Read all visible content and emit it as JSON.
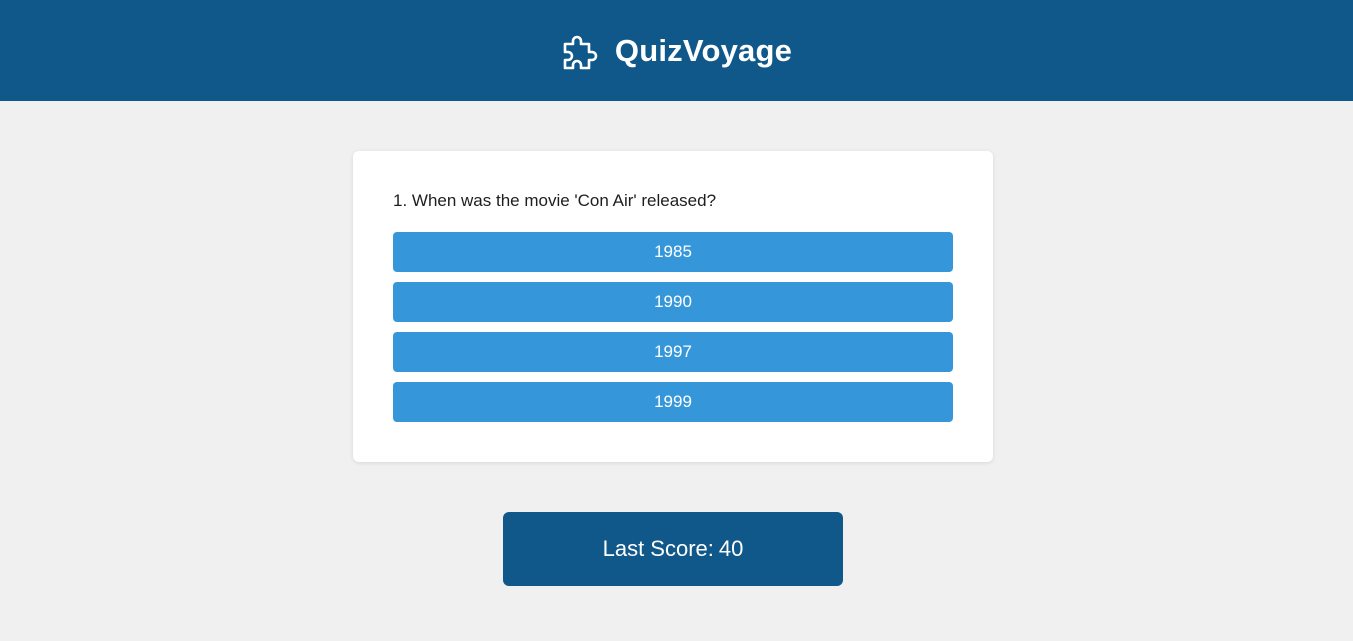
{
  "header": {
    "logo_icon": "puzzle-piece-icon",
    "title": "QuizVoyage"
  },
  "quiz": {
    "question": "1. When was the movie 'Con Air' released?",
    "answers": [
      "1985",
      "1990",
      "1997",
      "1999"
    ]
  },
  "score": {
    "label": "Last Score:",
    "value": "40"
  },
  "colors": {
    "header_bg": "#10588a",
    "answer_bg": "#3597d9",
    "page_bg": "#f0f0f0",
    "card_bg": "#ffffff"
  }
}
